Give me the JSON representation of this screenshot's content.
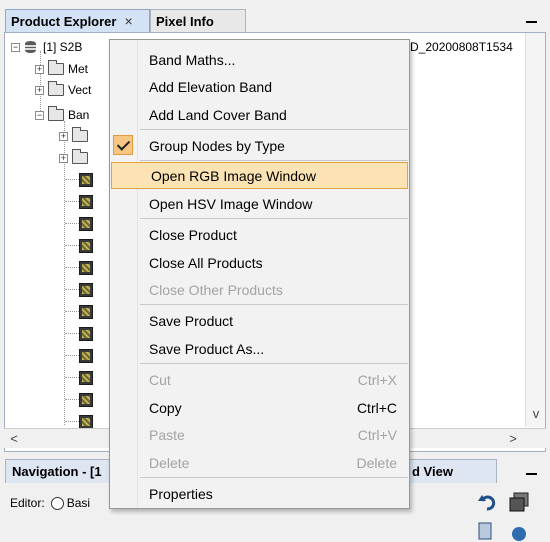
{
  "tabs": [
    {
      "label": "Product Explorer",
      "close": "×"
    },
    {
      "label": "Pixel Info"
    }
  ],
  "tree": {
    "product_label": "[1] S2B",
    "product_label_tail": "D_20200808T1534",
    "nodes": [
      "Met",
      "Vect",
      "Ban"
    ]
  },
  "context_menu": {
    "items": [
      {
        "label": "Band Maths...",
        "shortcut": "",
        "enabled": true
      },
      {
        "label": "Add Elevation Band",
        "shortcut": "",
        "enabled": true
      },
      {
        "label": "Add Land Cover Band",
        "shortcut": "",
        "enabled": true
      },
      {
        "label": "Group Nodes by Type",
        "shortcut": "",
        "enabled": true,
        "checked": true
      },
      {
        "label": "Open RGB Image Window",
        "shortcut": "",
        "enabled": true,
        "highlighted": true
      },
      {
        "label": "Open HSV Image Window",
        "shortcut": "",
        "enabled": true
      },
      {
        "label": "Close Product",
        "shortcut": "",
        "enabled": true
      },
      {
        "label": "Close All Products",
        "shortcut": "",
        "enabled": true
      },
      {
        "label": "Close Other Products",
        "shortcut": "",
        "enabled": false
      },
      {
        "label": "Save Product",
        "shortcut": "",
        "enabled": true
      },
      {
        "label": "Save Product As...",
        "shortcut": "",
        "enabled": true
      },
      {
        "label": "Cut",
        "shortcut": "Ctrl+X",
        "enabled": false
      },
      {
        "label": "Copy",
        "shortcut": "Ctrl+C",
        "enabled": true
      },
      {
        "label": "Paste",
        "shortcut": "Ctrl+V",
        "enabled": false
      },
      {
        "label": "Delete",
        "shortcut": "Delete",
        "enabled": false
      },
      {
        "label": "Properties",
        "shortcut": "",
        "enabled": true
      }
    ]
  },
  "bottom": {
    "nav_tab": "Navigation - [1",
    "right_tab": "d View",
    "editor_label": "Editor:",
    "basic_label": "Basi"
  },
  "scroll": {
    "left": "<",
    "right": ">",
    "down": "v"
  }
}
